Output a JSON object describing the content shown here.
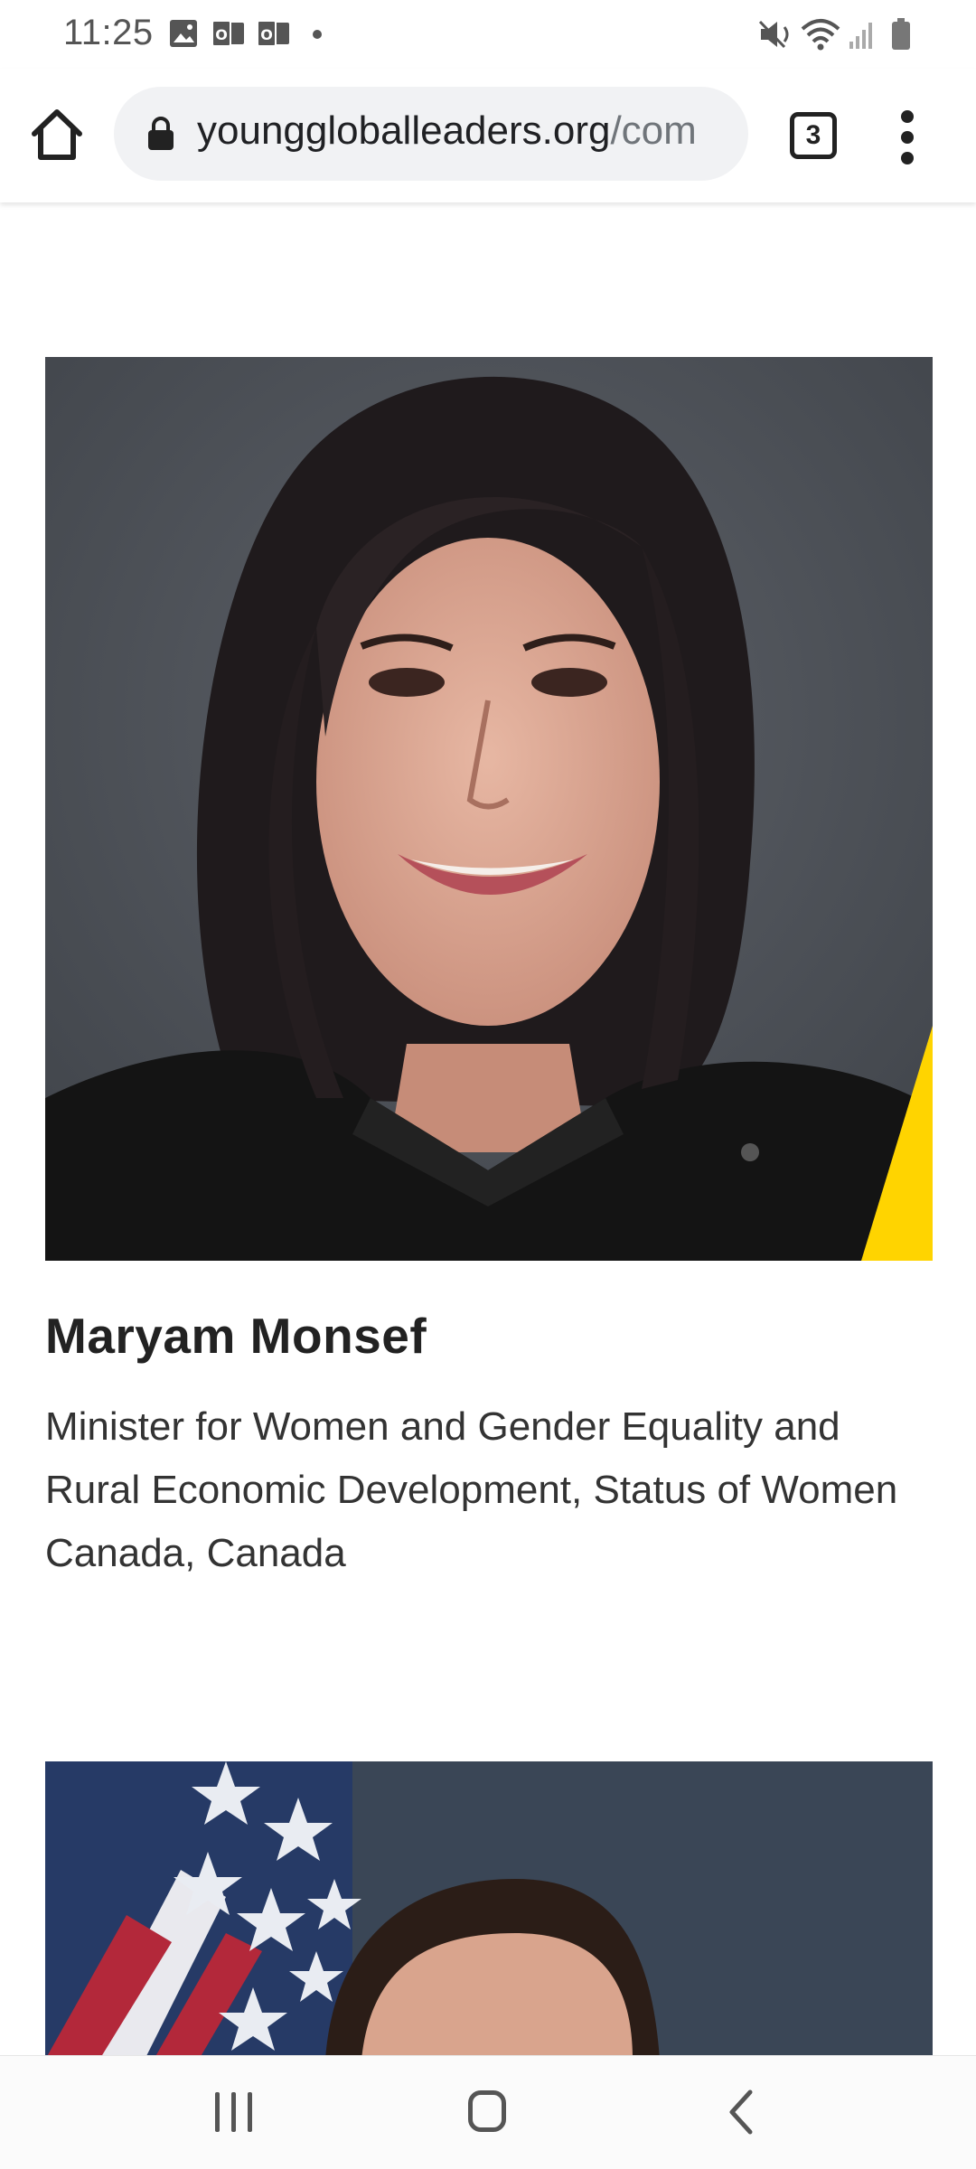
{
  "status_bar": {
    "time": "11:25",
    "left_icons": [
      "image-icon",
      "outlook-icon",
      "outlook-icon",
      "dot-icon"
    ],
    "right_icons": [
      "mute-vibrate-icon",
      "wifi-icon",
      "signal-icon",
      "battery-icon"
    ]
  },
  "browser": {
    "url_host": "younggloballeaders.org",
    "url_path": "/com",
    "tab_count": "3"
  },
  "profiles": [
    {
      "name": "Maryam Monsef",
      "title": "Minister for Women and Gender Equality and Rural Economic Development, Status of Women Canada, Canada"
    }
  ],
  "colors": {
    "accent_yellow": "#ffd400",
    "photo_background": "#4b5057"
  }
}
